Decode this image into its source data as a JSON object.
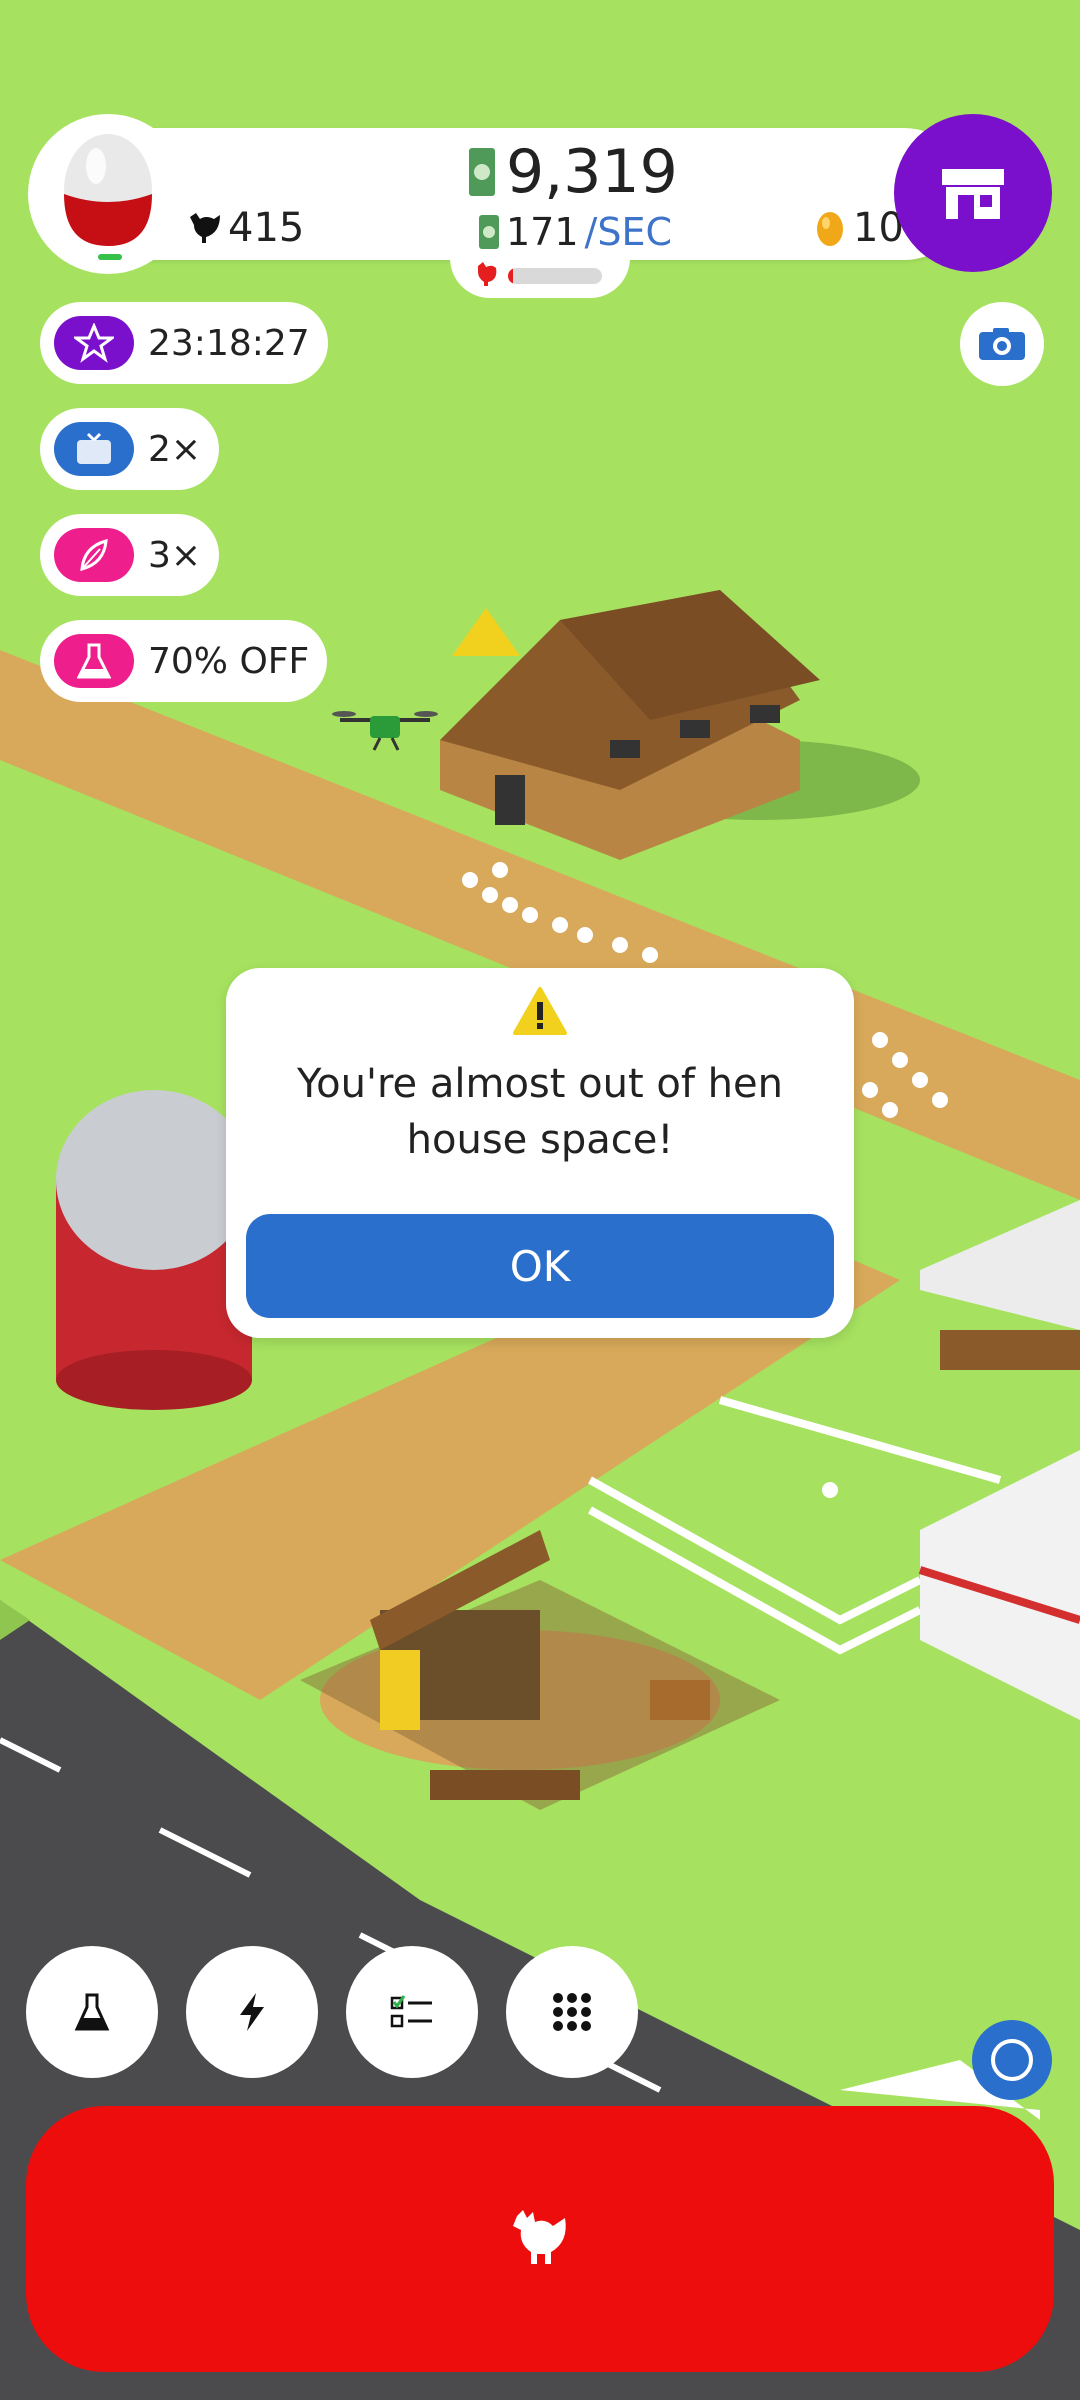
{
  "colors": {
    "grass": "#a6e25f",
    "road": "#4b4b4d",
    "dirt": "#d8a95a",
    "accent_purple": "#7a10cc",
    "accent_blue": "#2a6fcb",
    "hatch_red": "#ee0d0d",
    "pink": "#ee1f8c"
  },
  "stats": {
    "cash_amount": "9,319",
    "cash_rate_value": "171",
    "cash_rate_unit": "/SEC",
    "chicken_count": "415",
    "golden_eggs": "10",
    "hen_house_fill_fraction": 0.05
  },
  "boosts": [
    {
      "icon": "star-icon",
      "text": "23:18:27",
      "color": "#7a10cc"
    },
    {
      "icon": "tv-icon",
      "text": "2×",
      "color": "#2a6fcb"
    },
    {
      "icon": "feather-icon",
      "text": "3×",
      "color": "#ee1f8c"
    },
    {
      "icon": "flask-icon",
      "text": "70% OFF",
      "color": "#ee1f8c"
    }
  ],
  "dialog": {
    "icon": "warning-icon",
    "message": "You're almost out of hen house space!",
    "ok_label": "OK"
  },
  "bottom_buttons": [
    "research-flask-icon",
    "boost-lightning-icon",
    "missions-checklist-icon",
    "menu-grid-icon"
  ],
  "hatch_button_icon": "chicken-icon"
}
